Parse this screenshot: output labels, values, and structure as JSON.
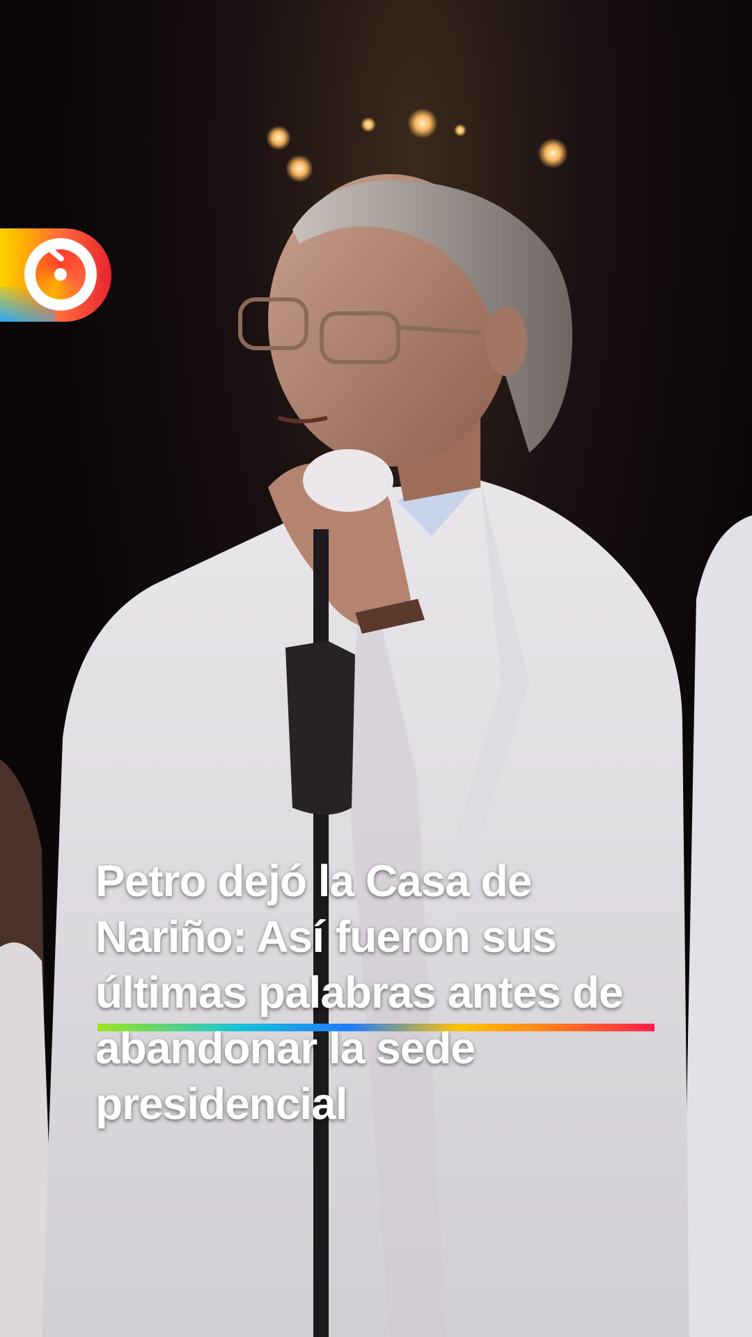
{
  "brand": {
    "logo_icon": "speedometer-logo-icon",
    "colors": {
      "yellow": "#ffd400",
      "orange": "#ff6a3c",
      "red": "#e8242f",
      "blue": "#27a4ff"
    }
  },
  "headline": {
    "text": "Petro dejó la Casa de Nariño: Así fueron sus últimas palabras antes de abandonar la sede presidencial"
  },
  "accent_bar": {
    "colors": [
      "#9be51a",
      "#19c4d8",
      "#1d7bff",
      "#ffc400",
      "#ff7a1a",
      "#ff1f4b"
    ]
  }
}
